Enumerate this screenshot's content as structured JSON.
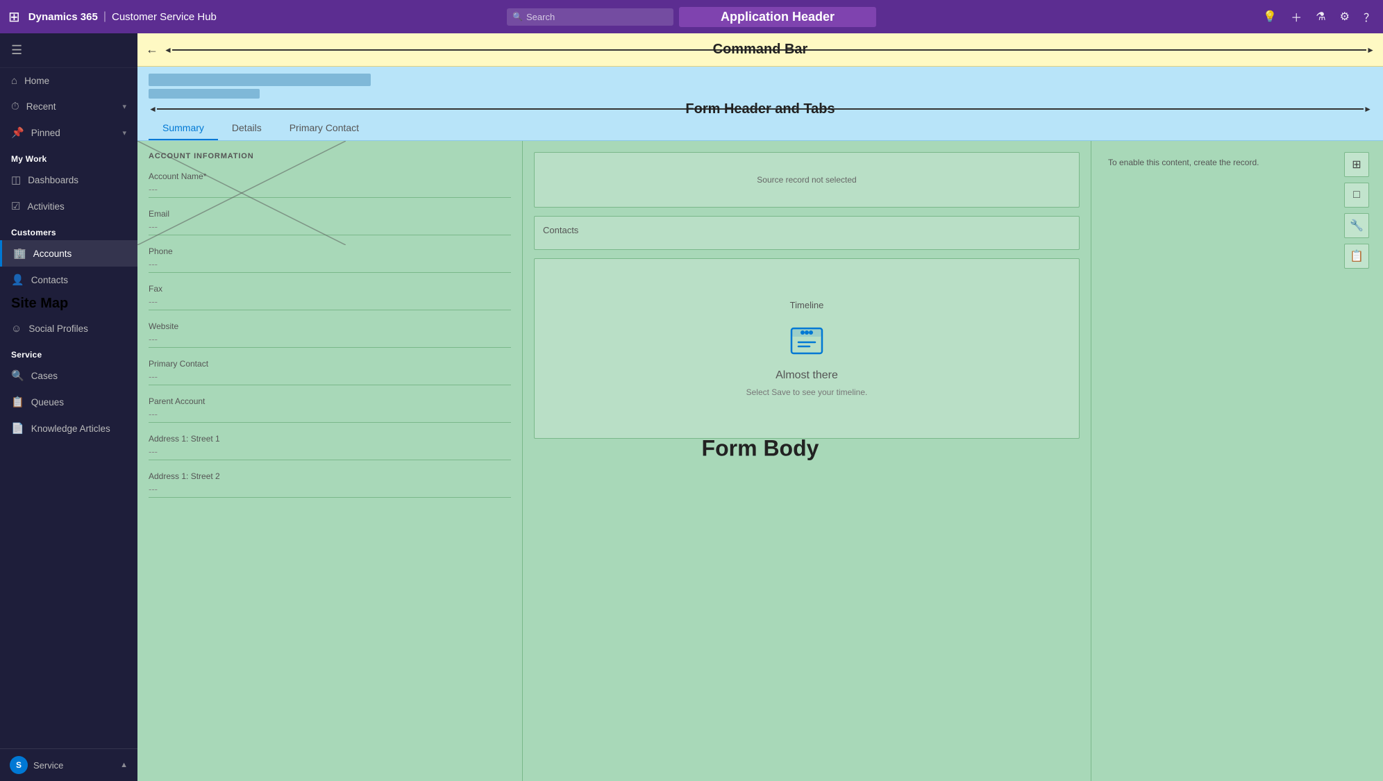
{
  "app": {
    "waffle_icon": "⊞",
    "brand": "Dynamics 365",
    "separator": "|",
    "app_name": "Customer Service Hub",
    "search_placeholder": "Search",
    "header_title": "Application Header",
    "icons": {
      "lightbulb": "💡",
      "plus": "+",
      "funnel": "⚗",
      "gear": "⚙",
      "help": "?"
    }
  },
  "command_bar": {
    "title": "Command Bar",
    "back_icon": "←"
  },
  "form_header": {
    "title": "Form Header and Tabs",
    "tabs": [
      {
        "label": "Summary",
        "active": true
      },
      {
        "label": "Details",
        "active": false
      },
      {
        "label": "Primary Contact",
        "active": false
      }
    ]
  },
  "form_body": {
    "label": "Form Body",
    "left": {
      "section_title": "ACCOUNT INFORMATION",
      "fields": [
        {
          "label": "Account Name*",
          "value": "---"
        },
        {
          "label": "Email",
          "value": "---"
        },
        {
          "label": "Phone",
          "value": "---"
        },
        {
          "label": "Fax",
          "value": "---"
        },
        {
          "label": "Website",
          "value": "---"
        },
        {
          "label": "Primary Contact",
          "value": "---"
        },
        {
          "label": "Parent Account",
          "value": "---"
        },
        {
          "label": "Address 1: Street 1",
          "value": "---"
        },
        {
          "label": "Address 1: Street 2",
          "value": "---"
        }
      ]
    },
    "middle": {
      "source_widget": {
        "text": "Source record not selected"
      },
      "contacts_widget": {
        "title": "Contacts"
      },
      "timeline_widget": {
        "title": "Timeline",
        "icon": "🗂",
        "almost_there": "Almost there",
        "sub_text": "Select Save to see your timeline."
      }
    },
    "right": {
      "enable_text": "To enable this content, create the record.",
      "icons": [
        "⬜",
        "☐",
        "🔧",
        "📋"
      ]
    }
  },
  "sidebar": {
    "toggle_icon": "☰",
    "nav_items": [
      {
        "id": "home",
        "icon": "⌂",
        "label": "Home",
        "chevron": false
      },
      {
        "id": "recent",
        "icon": "⏱",
        "label": "Recent",
        "chevron": true
      },
      {
        "id": "pinned",
        "icon": "📌",
        "label": "Pinned",
        "chevron": true
      }
    ],
    "my_work_header": "My Work",
    "my_work_items": [
      {
        "id": "dashboards",
        "icon": "◫",
        "label": "Dashboards"
      },
      {
        "id": "activities",
        "icon": "☑",
        "label": "Activities"
      }
    ],
    "customers_header": "Customers",
    "customers_items": [
      {
        "id": "accounts",
        "icon": "🏢",
        "label": "Accounts",
        "active": true
      },
      {
        "id": "contacts",
        "icon": "👤",
        "label": "Contacts"
      },
      {
        "id": "social-profiles",
        "icon": "☺",
        "label": "Social Profiles"
      }
    ],
    "site_map_label": "Site Map",
    "service_header": "Service",
    "service_items": [
      {
        "id": "cases",
        "icon": "🔍",
        "label": "Cases"
      },
      {
        "id": "queues",
        "icon": "📋",
        "label": "Queues"
      },
      {
        "id": "knowledge-articles",
        "icon": "📄",
        "label": "Knowledge Articles"
      }
    ],
    "footer": {
      "avatar_letter": "S",
      "label": "Service",
      "chevron": "▲"
    }
  }
}
